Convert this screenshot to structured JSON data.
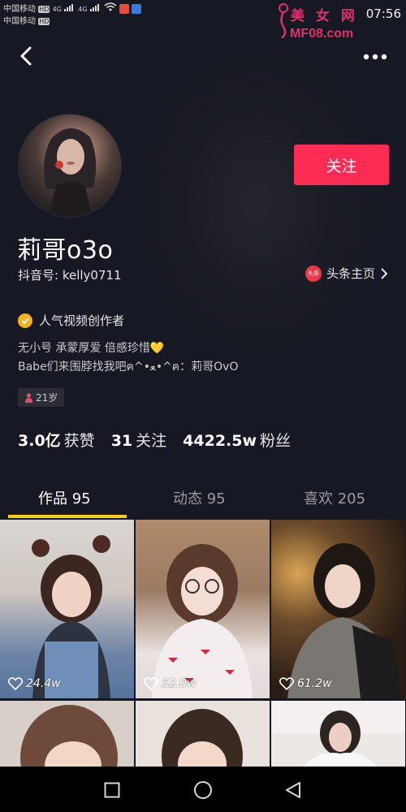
{
  "status_bar": {
    "carrier1": "中国移动",
    "carrier2": "中国移动",
    "badge": "HD",
    "network": "4G",
    "time": "07:56"
  },
  "watermark": {
    "line1": "美 女 网",
    "line2": "MF08.com"
  },
  "header": {
    "back_icon": "chevron-left-icon",
    "more_icon": "more-dots-icon"
  },
  "profile": {
    "follow_label": "关注",
    "nickname": "莉哥o3o",
    "douyin_id": "抖音号: kelly0711",
    "toutiao_icon_text": "头条",
    "toutiao_label": "头条主页",
    "verification": "人气视频创作者",
    "bio_line1": "无小号 承蒙厚爱 倍感珍惜💛",
    "bio_line2": "Babe们来围脖找我吧ฅ^•ﻌ•^ฅ：莉哥OvO",
    "age": "21岁"
  },
  "stats": [
    {
      "value": "3.0亿",
      "label": "获赞"
    },
    {
      "value": "31",
      "label": "关注"
    },
    {
      "value": "4422.5w",
      "label": "粉丝"
    }
  ],
  "tabs": [
    {
      "label": "作品 95"
    },
    {
      "label": "动态 95"
    },
    {
      "label": "喜欢 205"
    }
  ],
  "videos": [
    {
      "likes": "24.4w"
    },
    {
      "likes": "52.0w"
    },
    {
      "likes": "61.2w"
    },
    {
      "likes": ""
    },
    {
      "likes": ""
    },
    {
      "likes": ""
    }
  ],
  "colors": {
    "accent": "#fe2c55",
    "tab_indicator": "#face15",
    "background": "#161823"
  }
}
